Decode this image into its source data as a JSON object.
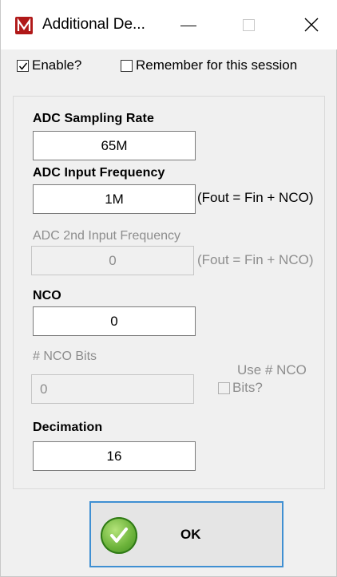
{
  "window": {
    "title": "Additional De...",
    "minimize_icon": "minimize-icon",
    "maximize_icon": "maximize-icon",
    "close_icon": "close-icon"
  },
  "options": {
    "enable_label": "Enable?",
    "enable_checked": true,
    "remember_label": "Remember for this session",
    "remember_checked": false
  },
  "form": {
    "adc_sampling_rate": {
      "label": "ADC Sampling Rate",
      "value": "65M"
    },
    "adc_input_frequency": {
      "label": "ADC Input  Frequency",
      "value": "1M",
      "note": "(Fout = Fin + NCO)"
    },
    "adc_2nd_input_frequency": {
      "label": "ADC 2nd Input  Frequency",
      "value": "0",
      "note": "(Fout = Fin + NCO)",
      "disabled": true
    },
    "nco": {
      "label": "NCO",
      "value": "0"
    },
    "nco_bits": {
      "label": "# NCO Bits",
      "value": "0",
      "disabled": true
    },
    "use_nco_bits": {
      "label_line1": "Use # NCO",
      "label_line2": "Bits?",
      "checked": false,
      "disabled": true
    },
    "decimation": {
      "label": "Decimation",
      "value": "16"
    }
  },
  "ok_button": {
    "label": "OK",
    "icon": "checkmark-icon"
  },
  "colors": {
    "accent": "#3f8fd2",
    "disabled_text": "#8d8d8d",
    "app_icon": "#b01818"
  }
}
